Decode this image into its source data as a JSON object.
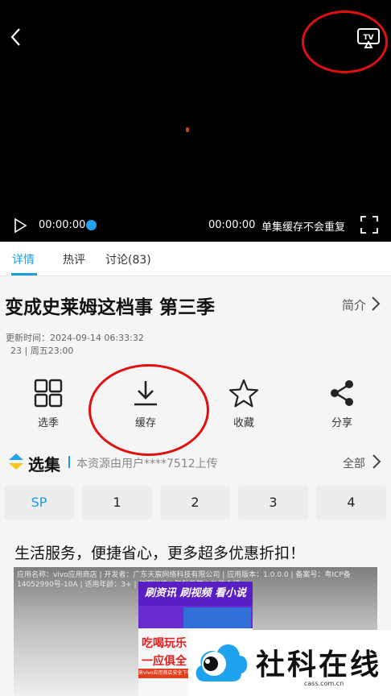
{
  "player": {
    "current_time": "00:00:00",
    "total_time": "00:00:00",
    "cache_note": "单集缓存不会重复",
    "progress": 0
  },
  "tabs": [
    {
      "label": "详情",
      "active": true
    },
    {
      "label": "热评"
    },
    {
      "label": "讨论(83)"
    }
  ],
  "detail": {
    "title": "变成史莱姆这档事 第三季",
    "intro_label": "简介",
    "update_time": "更新时间：2024-09-14 06:33:32",
    "meta": "23  |  周五23:00"
  },
  "actions": [
    {
      "label": "选季",
      "icon": "grid-icon"
    },
    {
      "label": "缓存",
      "icon": "download-icon"
    },
    {
      "label": "收藏",
      "icon": "star-icon"
    },
    {
      "label": "分享",
      "icon": "share-icon"
    }
  ],
  "episodes": {
    "title": "选集",
    "uploader": "本资源由用户****7512上传",
    "all_label": "全部",
    "items": [
      "SP",
      "1",
      "2",
      "3",
      "4"
    ],
    "selected": "SP"
  },
  "ad": {
    "title": "生活服务，便捷省心，更多超多优惠折扣！",
    "info": "应用名称：vivo应用商店 | 开发者：广东天宸网络科技有限公司 | 应用版本：1.0.0.0 | 备案号：粤ICP备14052990号-10A | 适用年龄：3+ | 权限详情 | 隐私政策 | 功能介绍",
    "poster_top": "刷资讯 刷视频 看小说",
    "poster_text1": "吃喝玩乐",
    "poster_text2": "一应俱全",
    "poster_red": "来vivo应用商店安全下载"
  },
  "watermark": {
    "text": "社科在线",
    "domain": "cass.com.cn"
  },
  "colors": {
    "accent": "#1c9be0",
    "annotation_red": "#e01010",
    "player_bg": "#000000"
  }
}
